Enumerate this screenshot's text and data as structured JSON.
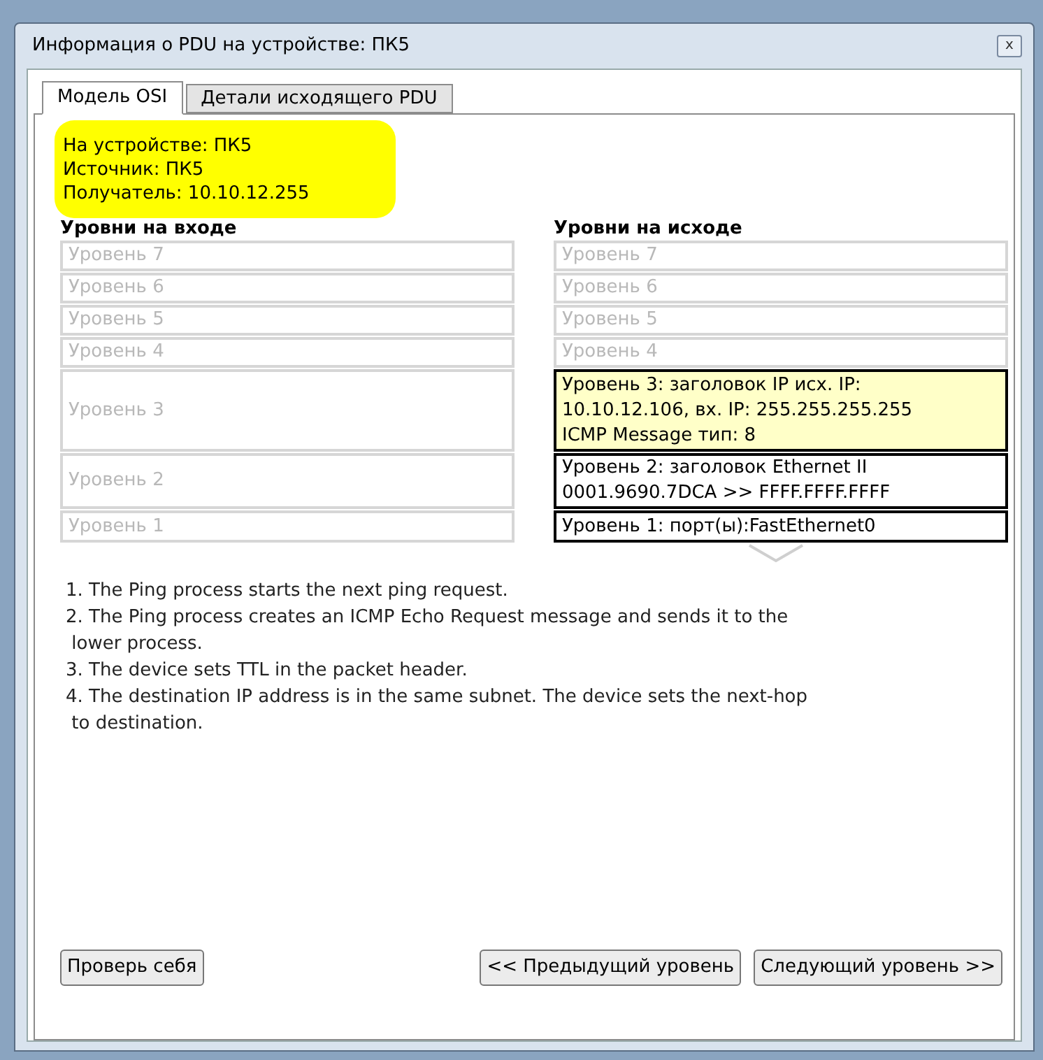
{
  "window": {
    "title": "Информация о PDU на устройстве: ПК5",
    "close": "x"
  },
  "tabs": [
    {
      "label": "Модель OSI",
      "selected": true
    },
    {
      "label": "Детали исходящего PDU",
      "selected": false
    }
  ],
  "info": [
    "На устройстве: ПК5",
    "Источник: ПК5",
    "Получатель: 10.10.12.255"
  ],
  "in_heading": "Уровни на входе",
  "out_heading": "Уровни на исходе",
  "layers": [
    {
      "in": {
        "text": "Уровень 7",
        "kind": "dim"
      },
      "out": {
        "text": "Уровень 7",
        "kind": "dim"
      }
    },
    {
      "in": {
        "text": "Уровень 6",
        "kind": "dim"
      },
      "out": {
        "text": "Уровень 6",
        "kind": "dim"
      }
    },
    {
      "in": {
        "text": "Уровень 5",
        "kind": "dim"
      },
      "out": {
        "text": "Уровень 5",
        "kind": "dim"
      }
    },
    {
      "in": {
        "text": "Уровень 4",
        "kind": "dim"
      },
      "out": {
        "text": "Уровень 4",
        "kind": "dim"
      }
    },
    {
      "in": {
        "text": "Уровень 3",
        "kind": "dim"
      },
      "out": {
        "text": "Уровень 3: заголовок IP исх. IP:\n10.10.12.106, вх. IP: 255.255.255.255\nICMP Message тип: 8",
        "kind": "current"
      }
    },
    {
      "in": {
        "text": "Уровень 2",
        "kind": "dim"
      },
      "out": {
        "text": "Уровень 2: заголовок Ethernet II\n0001.9690.7DCA >> FFFF.FFFF.FFFF",
        "kind": "active"
      }
    },
    {
      "in": {
        "text": "Уровень 1",
        "kind": "dim"
      },
      "out": {
        "text": "Уровень 1: порт(ы):FastEthernet0",
        "kind": "active"
      }
    }
  ],
  "steps": [
    "1. The Ping process starts the next ping request.",
    "2. The Ping process creates an ICMP Echo Request message and sends it to the\n lower process.",
    "3. The device sets TTL in the packet header.",
    "4. The destination IP address is in the same subnet. The device sets the next-hop\n to destination."
  ],
  "buttons": {
    "check": "Проверь себя",
    "prev": "<< Предыдущий уровень",
    "next": "Следующий уровень >>"
  }
}
